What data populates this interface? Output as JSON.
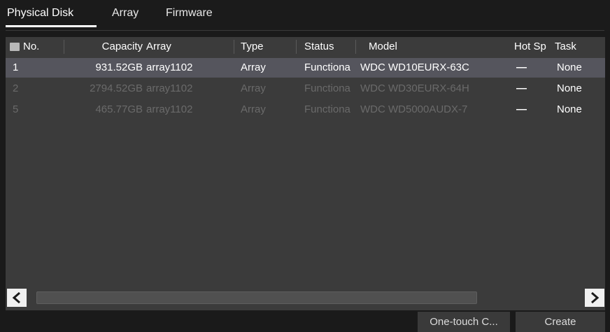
{
  "tabs": [
    {
      "label": "Physical Disk",
      "active": true
    },
    {
      "label": "Array",
      "active": false
    },
    {
      "label": "Firmware",
      "active": false
    }
  ],
  "table": {
    "headers": {
      "no": "No.",
      "capacity": "Capacity",
      "array": "Array",
      "type": "Type",
      "status": "Status",
      "model": "Model",
      "hot_spare": "Hot Sp",
      "task": "Task"
    },
    "rows": [
      {
        "no": "1",
        "capacity": "931.52GB",
        "array": "array1102",
        "type": "Array",
        "status": "Functiona",
        "model": "WDC WD10EURX-63C",
        "hot_spare": "—",
        "task": "None",
        "selected": true
      },
      {
        "no": "2",
        "capacity": "2794.52GB",
        "array": "array1102",
        "type": "Array",
        "status": "Functiona",
        "model": "WDC WD30EURX-64H",
        "hot_spare": "—",
        "task": "None",
        "selected": false
      },
      {
        "no": "5",
        "capacity": "465.77GB",
        "array": "array1102",
        "type": "Array",
        "status": "Functiona",
        "model": "WDC WD5000AUDX-7",
        "hot_spare": "—",
        "task": "None",
        "selected": false
      }
    ]
  },
  "buttons": {
    "one_touch": "One-touch C...",
    "create": "Create"
  },
  "colors": {
    "background": "#1a1a1a",
    "panel": "#3b3b3b",
    "selected_row": "#55555d",
    "text": "#ffffff",
    "dim_text": "#6a6a6a"
  }
}
